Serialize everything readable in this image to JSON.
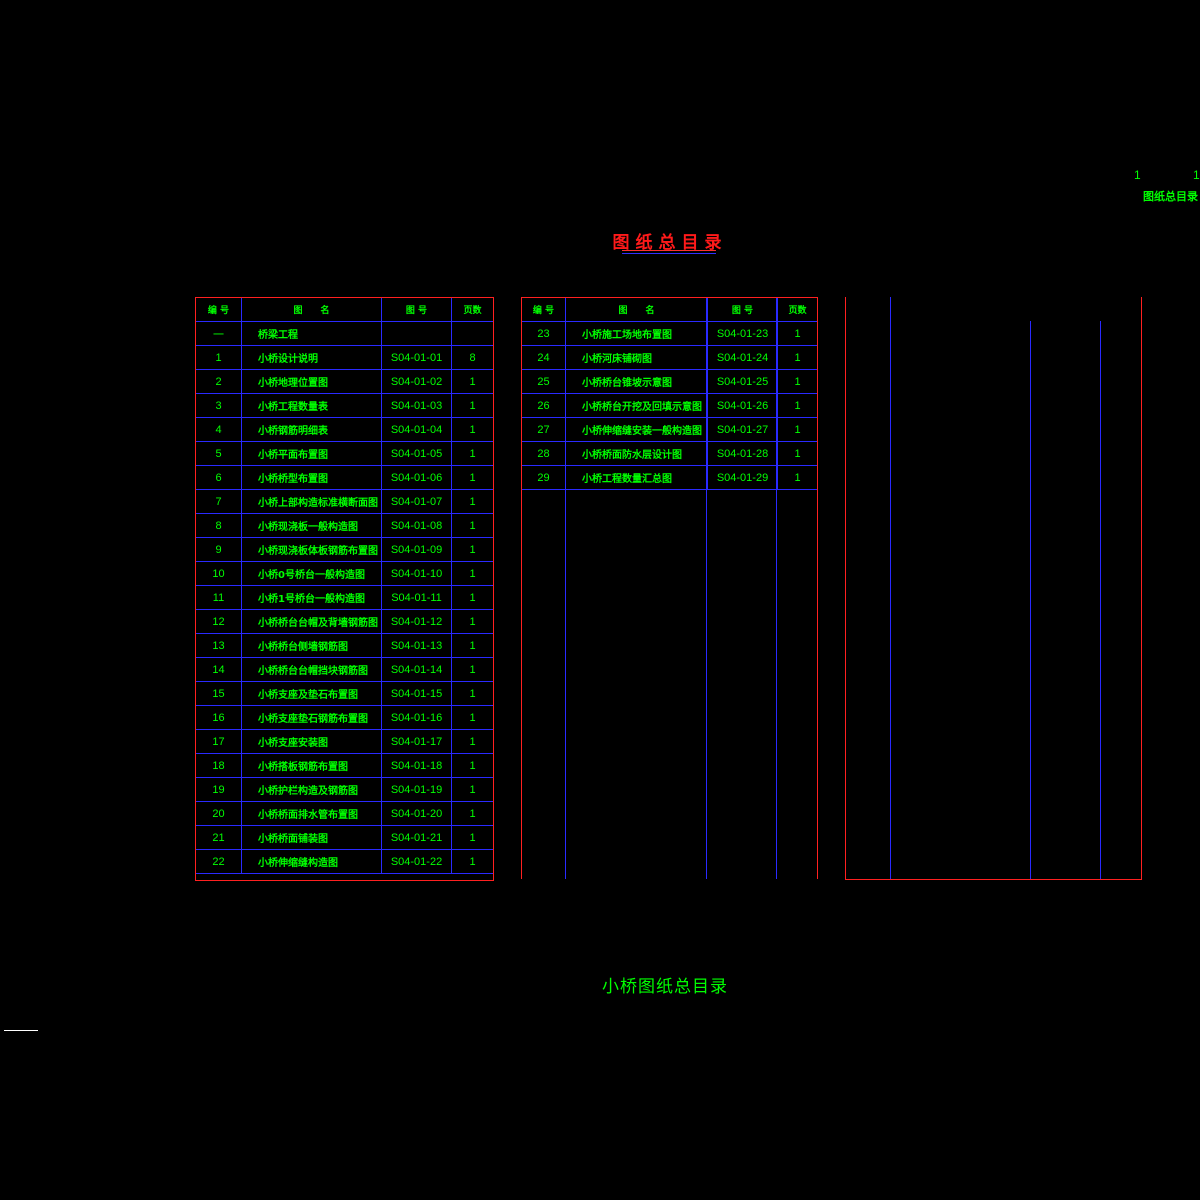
{
  "title": "图纸总目录",
  "corner": {
    "num_left": "1",
    "num_right": "1",
    "label": "图纸总目录"
  },
  "caption": "小桥图纸总目录",
  "headers": {
    "no": "编 号",
    "name": "图　　名",
    "code": "图 号",
    "pages": "页数"
  },
  "table1": [
    {
      "no": "一",
      "name": "桥梁工程",
      "code": "",
      "pages": ""
    },
    {
      "no": "1",
      "name": "小桥设计说明",
      "code": "S04-01-01",
      "pages": "8"
    },
    {
      "no": "2",
      "name": "小桥地理位置图",
      "code": "S04-01-02",
      "pages": "1"
    },
    {
      "no": "3",
      "name": "小桥工程数量表",
      "code": "S04-01-03",
      "pages": "1"
    },
    {
      "no": "4",
      "name": "小桥钢筋明细表",
      "code": "S04-01-04",
      "pages": "1"
    },
    {
      "no": "5",
      "name": "小桥平面布置图",
      "code": "S04-01-05",
      "pages": "1"
    },
    {
      "no": "6",
      "name": "小桥桥型布置图",
      "code": "S04-01-06",
      "pages": "1"
    },
    {
      "no": "7",
      "name": "小桥上部构造标准横断面图",
      "code": "S04-01-07",
      "pages": "1"
    },
    {
      "no": "8",
      "name": "小桥现浇板一般构造图",
      "code": "S04-01-08",
      "pages": "1"
    },
    {
      "no": "9",
      "name": "小桥现浇板体板钢筋布置图",
      "code": "S04-01-09",
      "pages": "1"
    },
    {
      "no": "10",
      "name": "小桥0号桥台一般构造图",
      "code": "S04-01-10",
      "pages": "1"
    },
    {
      "no": "11",
      "name": "小桥1号桥台一般构造图",
      "code": "S04-01-11",
      "pages": "1"
    },
    {
      "no": "12",
      "name": "小桥桥台台帽及背墙钢筋图",
      "code": "S04-01-12",
      "pages": "1"
    },
    {
      "no": "13",
      "name": "小桥桥台侧墙钢筋图",
      "code": "S04-01-13",
      "pages": "1"
    },
    {
      "no": "14",
      "name": "小桥桥台台帽挡块钢筋图",
      "code": "S04-01-14",
      "pages": "1"
    },
    {
      "no": "15",
      "name": "小桥支座及垫石布置图",
      "code": "S04-01-15",
      "pages": "1"
    },
    {
      "no": "16",
      "name": "小桥支座垫石钢筋布置图",
      "code": "S04-01-16",
      "pages": "1"
    },
    {
      "no": "17",
      "name": "小桥支座安装图",
      "code": "S04-01-17",
      "pages": "1"
    },
    {
      "no": "18",
      "name": "小桥搭板钢筋布置图",
      "code": "S04-01-18",
      "pages": "1"
    },
    {
      "no": "19",
      "name": "小桥护栏构造及钢筋图",
      "code": "S04-01-19",
      "pages": "1"
    },
    {
      "no": "20",
      "name": "小桥桥面排水管布置图",
      "code": "S04-01-20",
      "pages": "1"
    },
    {
      "no": "21",
      "name": "小桥桥面铺装图",
      "code": "S04-01-21",
      "pages": "1"
    },
    {
      "no": "22",
      "name": "小桥伸缩缝构造图",
      "code": "S04-01-22",
      "pages": "1"
    }
  ],
  "table2": [
    {
      "no": "23",
      "name": "小桥施工场地布置图",
      "code": "S04-01-23",
      "pages": "1"
    },
    {
      "no": "24",
      "name": "小桥河床铺砌图",
      "code": "S04-01-24",
      "pages": "1"
    },
    {
      "no": "25",
      "name": "小桥桥台锥坡示意图",
      "code": "S04-01-25",
      "pages": "1"
    },
    {
      "no": "26",
      "name": "小桥桥台开挖及回填示意图",
      "code": "S04-01-26",
      "pages": "1"
    },
    {
      "no": "27",
      "name": "小桥伸缩缝安装一般构造图",
      "code": "S04-01-27",
      "pages": "1"
    },
    {
      "no": "28",
      "name": "小桥桥面防水层设计图",
      "code": "S04-01-28",
      "pages": "1"
    },
    {
      "no": "29",
      "name": "小桥工程数量汇总图",
      "code": "S04-01-29",
      "pages": "1"
    }
  ]
}
